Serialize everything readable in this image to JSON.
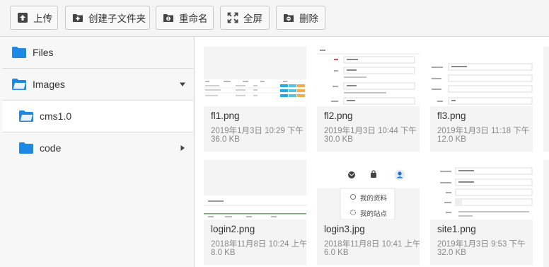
{
  "toolbar": {
    "upload": "上传",
    "new_folder": "创建子文件夹",
    "rename": "重命名",
    "fullscreen": "全屏",
    "delete": "删除"
  },
  "tree": {
    "files": "Files",
    "images": "Images",
    "cms": "cms1.0",
    "code": "code"
  },
  "files": [
    {
      "name": "fl1.png",
      "date": "2019年1月3日 10:29 下午",
      "size": "36.0 KB"
    },
    {
      "name": "fl2.png",
      "date": "2019年1月3日 10:44 下午",
      "size": "30.0 KB"
    },
    {
      "name": "fl3.png",
      "date": "2019年1月3日 11:18 下午",
      "size": "12.0 KB"
    },
    {
      "name": "login2.png",
      "date": "2018年11月8日 10:24 上午",
      "size": "8.0 KB"
    },
    {
      "name": "login3.jpg",
      "date": "2018年11月8日 10:41 上午",
      "size": "6.0 KB"
    },
    {
      "name": "site1.png",
      "date": "2019年1月3日 9:53 下午",
      "size": "32.0 KB"
    }
  ],
  "thumbs": {
    "login3_menu_profile": "我的资料",
    "login3_menu_site": "我的站点"
  },
  "colors": {
    "folder": "#1e88e5",
    "accent": "#29a9e1"
  }
}
